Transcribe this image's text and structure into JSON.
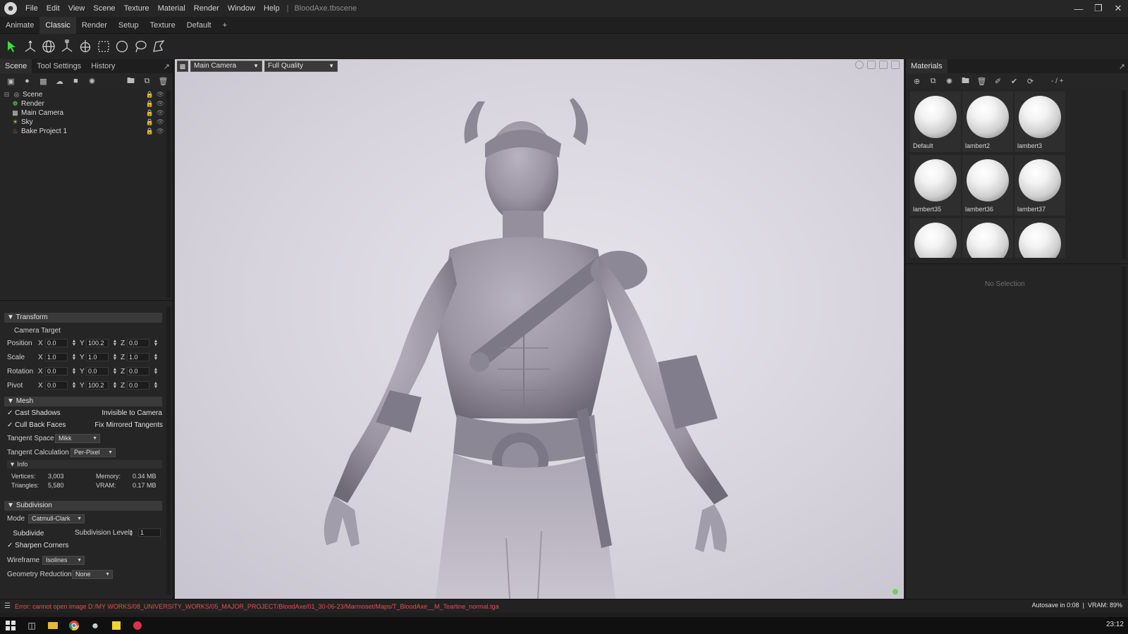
{
  "app": {
    "menus": [
      "File",
      "Edit",
      "View",
      "Scene",
      "Texture",
      "Material",
      "Render",
      "Window",
      "Help"
    ],
    "file_title": "BloodAxe.tbscene"
  },
  "workspace_tabs": [
    "Animate",
    "Classic",
    "Render",
    "Setup",
    "Texture",
    "Default",
    "+"
  ],
  "left_panel": {
    "tabs": [
      "Scene",
      "Tool Settings",
      "History"
    ],
    "tree": [
      {
        "label": "Scene",
        "icon": "scene-icon"
      },
      {
        "label": "Render",
        "icon": "render-icon"
      },
      {
        "label": "Main Camera",
        "icon": "camera-icon"
      },
      {
        "label": "Sky",
        "icon": "sky-icon"
      },
      {
        "label": "Bake Project 1",
        "icon": "bake-icon"
      }
    ],
    "transform": {
      "title": "Transform",
      "camera_target": "Camera Target",
      "rows": [
        {
          "label": "Position",
          "x": "0.0",
          "y": "100.2",
          "z": "0.0"
        },
        {
          "label": "Scale",
          "x": "1.0",
          "y": "1.0",
          "z": "1.0"
        },
        {
          "label": "Rotation",
          "x": "0.0",
          "y": "0.0",
          "z": "0.0"
        },
        {
          "label": "Pivot",
          "x": "0.0",
          "y": "100.2",
          "z": "0.0"
        }
      ]
    },
    "mesh": {
      "title": "Mesh",
      "cast_shadows": "Cast Shadows",
      "invisible_to_camera": "Invisible to Camera",
      "cull_back_faces": "Cull Back Faces",
      "fix_mirrored_tangents": "Fix Mirrored Tangents",
      "tangent_space_label": "Tangent Space",
      "tangent_space_value": "Mikk",
      "tangent_calc_label": "Tangent Calculation",
      "tangent_calc_value": "Per-Pixel",
      "info_title": "Info",
      "vertices_label": "Vertices:",
      "vertices_value": "3,003",
      "triangles_label": "Triangles:",
      "triangles_value": "5,580",
      "memory_label": "Memory:",
      "memory_value": "0.34 MB",
      "vram_label": "VRAM:",
      "vram_value": "0.17 MB"
    },
    "subdivision": {
      "title": "Subdivision",
      "mode_label": "Mode",
      "mode_value": "Catmull-Clark",
      "subdivide": "Subdivide",
      "level_label": "Subdivision Level",
      "level_value": "1",
      "sharpen_corners": "Sharpen Corners",
      "wireframe_label": "Wireframe",
      "wireframe_value": "Isolines",
      "geo_reduction_label": "Geometry Reduction",
      "geo_reduction_value": "None"
    }
  },
  "viewport": {
    "camera": "Main Camera",
    "quality": "Full Quality"
  },
  "materials": {
    "title": "Materials",
    "page_indicator": "- / +",
    "items": [
      "Default",
      "lambert2",
      "lambert3",
      "lambert35",
      "lambert36",
      "lambert37",
      "",
      "",
      ""
    ],
    "no_selection": "No Selection"
  },
  "status": {
    "error": "Error: cannot open image D:/MY WORKS/08_UNIVERSITY_WORKS/05_MAJOR_PROJECT/BloodAxe/01_30-06-23/Marmoset/Maps/T_BloodAxe__M_Tearline_normal.tga",
    "autosave": "Autosave in 0:08",
    "vram": "VRAM: 89%"
  },
  "taskbar": {
    "time": "23:12"
  }
}
